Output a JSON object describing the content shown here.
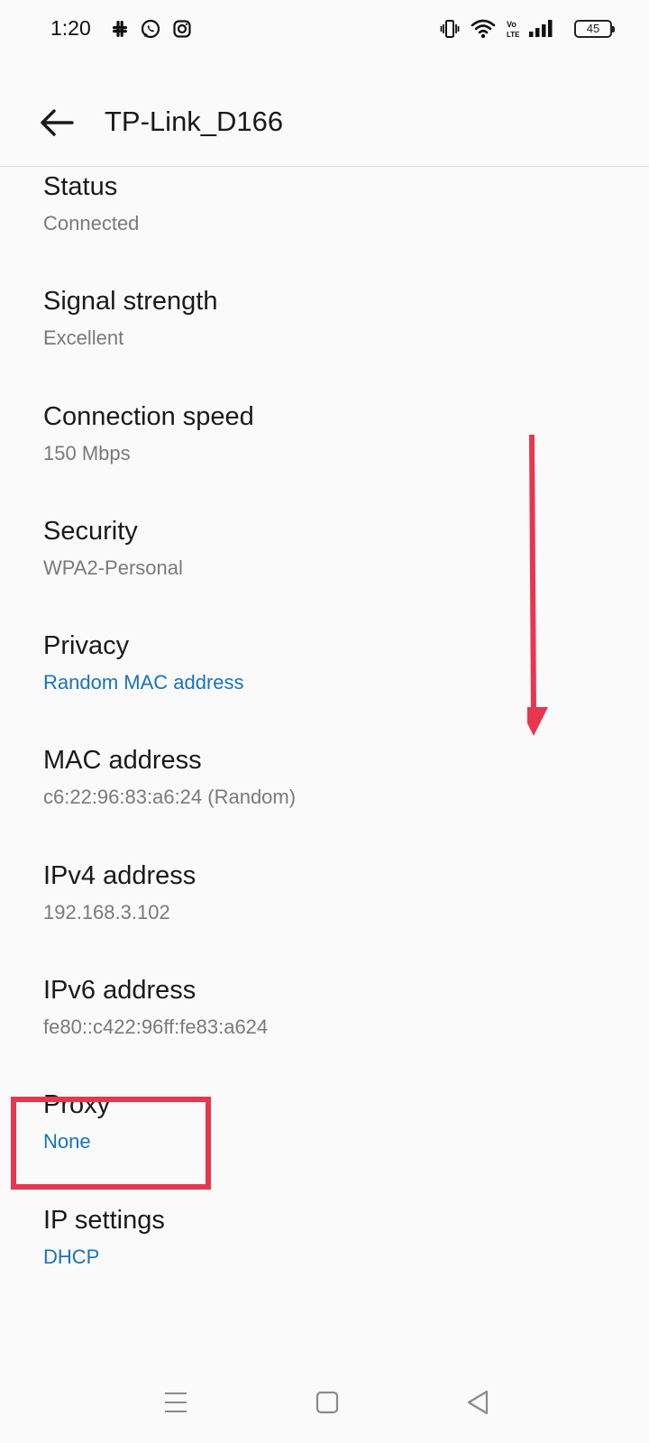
{
  "status_bar": {
    "time": "1:20",
    "battery": "45",
    "left_icons": [
      "slack-icon",
      "whatsapp-icon",
      "instagram-icon"
    ],
    "right_icons": [
      "vibrate-icon",
      "wifi-icon",
      "volte-icon",
      "signal-icon",
      "battery-icon"
    ]
  },
  "app_bar": {
    "title": "TP-Link_D166",
    "back_icon": "arrow-left-icon"
  },
  "details": [
    {
      "label": "Status",
      "value": "Connected"
    },
    {
      "label": "Signal strength",
      "value": "Excellent"
    },
    {
      "label": "Connection speed",
      "value": "150 Mbps"
    },
    {
      "label": "Security",
      "value": "WPA2-Personal"
    },
    {
      "label": "Privacy",
      "value": "Random MAC address"
    },
    {
      "label": "MAC address",
      "value": "c6:22:96:83:a6:24 (Random)"
    },
    {
      "label": "IPv4 address",
      "value": "192.168.3.102"
    },
    {
      "label": "IPv6 address",
      "value": "fe80::c422:96ff:fe83:a624"
    },
    {
      "label": "Proxy",
      "value": "None"
    },
    {
      "label": "IP settings",
      "value": "DHCP"
    }
  ],
  "annotation": {
    "highlighted_item": "Proxy",
    "arrow_direction": "down",
    "color": "#e8364f"
  },
  "colors": {
    "link": "#1a73b8",
    "secondary_text": "#7a7a7a",
    "background": "#fafafa"
  },
  "nav_bar": {
    "icons": [
      "menu-icon",
      "home-icon",
      "back-triangle-icon"
    ]
  }
}
